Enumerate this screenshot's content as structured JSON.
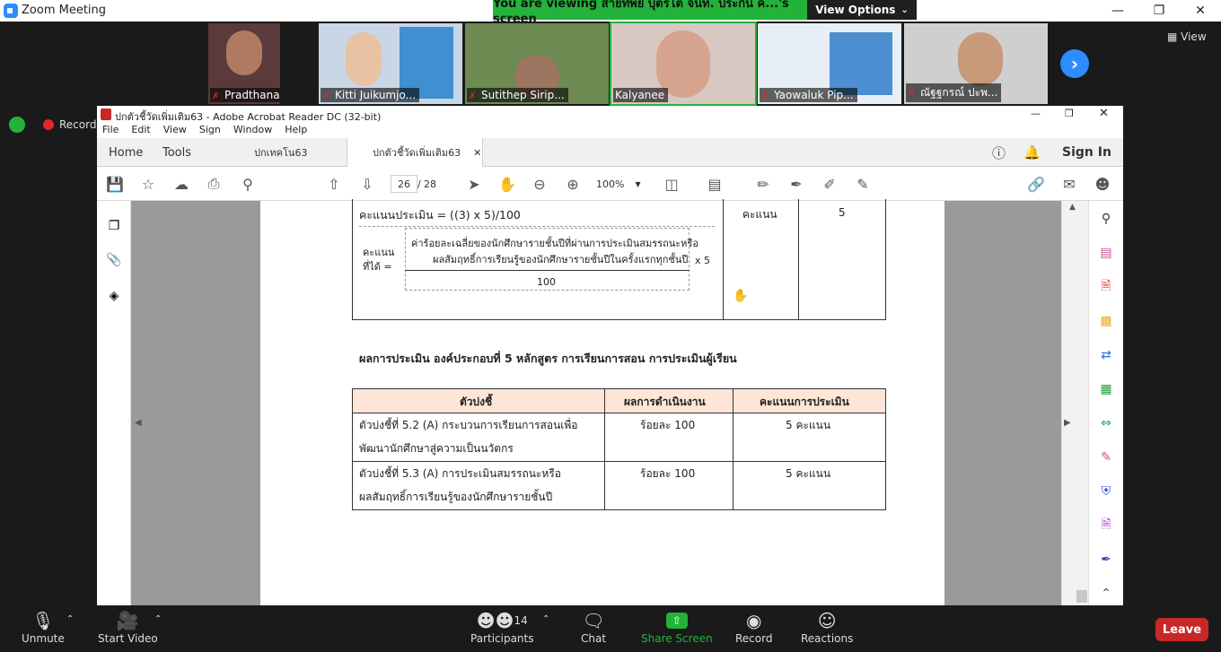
{
  "zoom": {
    "app_title": "Zoom Meeting",
    "banner": "You are viewing สายทิพย์ บุตรโต จนท. ประกัน ค...'s screen",
    "view_options": "View Options",
    "view_label": "View",
    "recording": "Recordin",
    "participants_count": "14",
    "participants": [
      {
        "name": "Pradthana M..."
      },
      {
        "name": "Kitti Juikumjo..."
      },
      {
        "name": "Sutithep Sirip..."
      },
      {
        "name": "Kalyanee"
      },
      {
        "name": "Yaowaluk Pip..."
      },
      {
        "name": "ณัฐฐกรณ์ ปะพ..."
      }
    ],
    "bottom": {
      "unmute": "Unmute",
      "start_video": "Start Video",
      "participants": "Participants",
      "chat": "Chat",
      "share_screen": "Share Screen",
      "record": "Record",
      "reactions": "Reactions",
      "leave": "Leave"
    },
    "colors": {
      "accent": "#2d8cff",
      "banner": "#23b33a",
      "leave": "#c62828"
    }
  },
  "acrobat": {
    "window_title": "ปกตัวชี้วัดเพิ่มเติม63 - Adobe Acrobat Reader DC (32-bit)",
    "menu": [
      "File",
      "Edit",
      "View",
      "Sign",
      "Window",
      "Help"
    ],
    "tabs": {
      "home": "Home",
      "tools": "Tools",
      "doc1": "ปกเทคโน63",
      "doc2": "ปกตัวชี้วัดเพิ่มเติม63"
    },
    "sign_in": "Sign In",
    "page_current": "26",
    "page_sep": "/",
    "page_total": "28",
    "zoom": "100%"
  },
  "document": {
    "formula_line": "คะแนนประเมิน = ((3) x 5)/100",
    "score_label": "คะแนนที่ได้ =",
    "numerator_1": "ค่าร้อยละเฉลี่ยของนักศึกษารายชั้นปีที่ผ่านการประเมินสมรรถนะหรือ",
    "numerator_2": "ผลสัมฤทธิ์การเรียนรู้ของนักศึกษารายชั้นปีในครั้งแรกทุกชั้นปี",
    "denominator": "100",
    "multiplier": "x 5",
    "unit_cell": "คะแนน",
    "value_cell": "5",
    "section_heading": "ผลการประเมิน องค์ประกอบที่  5 หลักสูตร การเรียนการสอน การประเมินผู้เรียน",
    "table": {
      "headers": [
        "ตัวบ่งชี้",
        "ผลการดำเนินงาน",
        "คะแนนการประเมิน"
      ],
      "rows": [
        {
          "line1": "ตัวบ่งชี้ที่ 5.2 (A)  กระบวนการเรียนการสอนเพื่อ",
          "line2": "พัฒนานักศึกษาสู่ความเป็นนวัตกร",
          "result": "ร้อยละ 100",
          "score": "5 คะแนน"
        },
        {
          "line1": "ตัวบ่งชี้ที่ 5.3 (A)  การประเมินสมรรถนะหรือ",
          "line2": "ผลสัมฤทธิ์การเรียนรู้ของนักศึกษารายชั้นปี",
          "result": "ร้อยละ 100",
          "score": "5 คะแนน"
        }
      ]
    }
  }
}
